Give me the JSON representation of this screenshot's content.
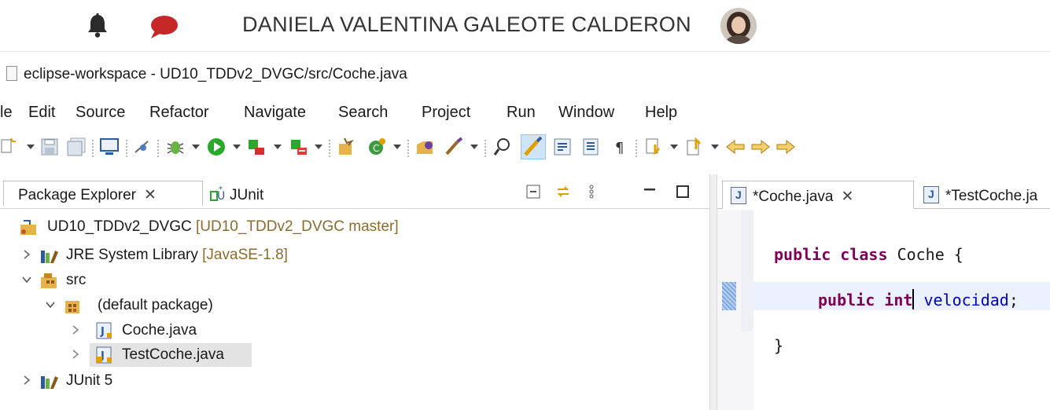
{
  "userbar": {
    "username": "DANIELA VALENTINA GALEOTE CALDERON",
    "bell_icon": "bell-icon",
    "chat_icon": "chat-bubble-icon"
  },
  "window": {
    "title": "eclipse-workspace - UD10_TDDv2_DVGC/src/Coche.java"
  },
  "menu": {
    "items": [
      "le",
      "Edit",
      "Source",
      "Refactor",
      "Navigate",
      "Search",
      "Project",
      "Run",
      "Window",
      "Help"
    ]
  },
  "left_panel": {
    "tabs": {
      "package_explorer": "Package Explorer",
      "junit": "JUnit"
    },
    "tree": {
      "project": "UD10_TDDv2_DVGC",
      "project_decoration": "[UD10_TDDv2_DVGC master]",
      "jre": "JRE System Library",
      "jre_decoration": "[JavaSE-1.8]",
      "src": "src",
      "default_package": "(default package)",
      "coche": "Coche.java",
      "testcoche": "TestCoche.java",
      "junit5": "JUnit 5"
    }
  },
  "editor": {
    "tabs": {
      "active": "*Coche.java",
      "inactive": "*TestCoche.ja"
    },
    "code": {
      "line1_kw1": "public",
      "line1_kw2": "class",
      "line1_rest": "Coche {",
      "line2_kw1": "public",
      "line2_kw2": "int",
      "line2_field": "velocidad",
      "line2_end": ";",
      "line3": "}"
    }
  },
  "colors": {
    "keyword": "#7f0055",
    "field": "#0000c0",
    "chat": "#c62828",
    "bell": "#2b2b2b"
  }
}
